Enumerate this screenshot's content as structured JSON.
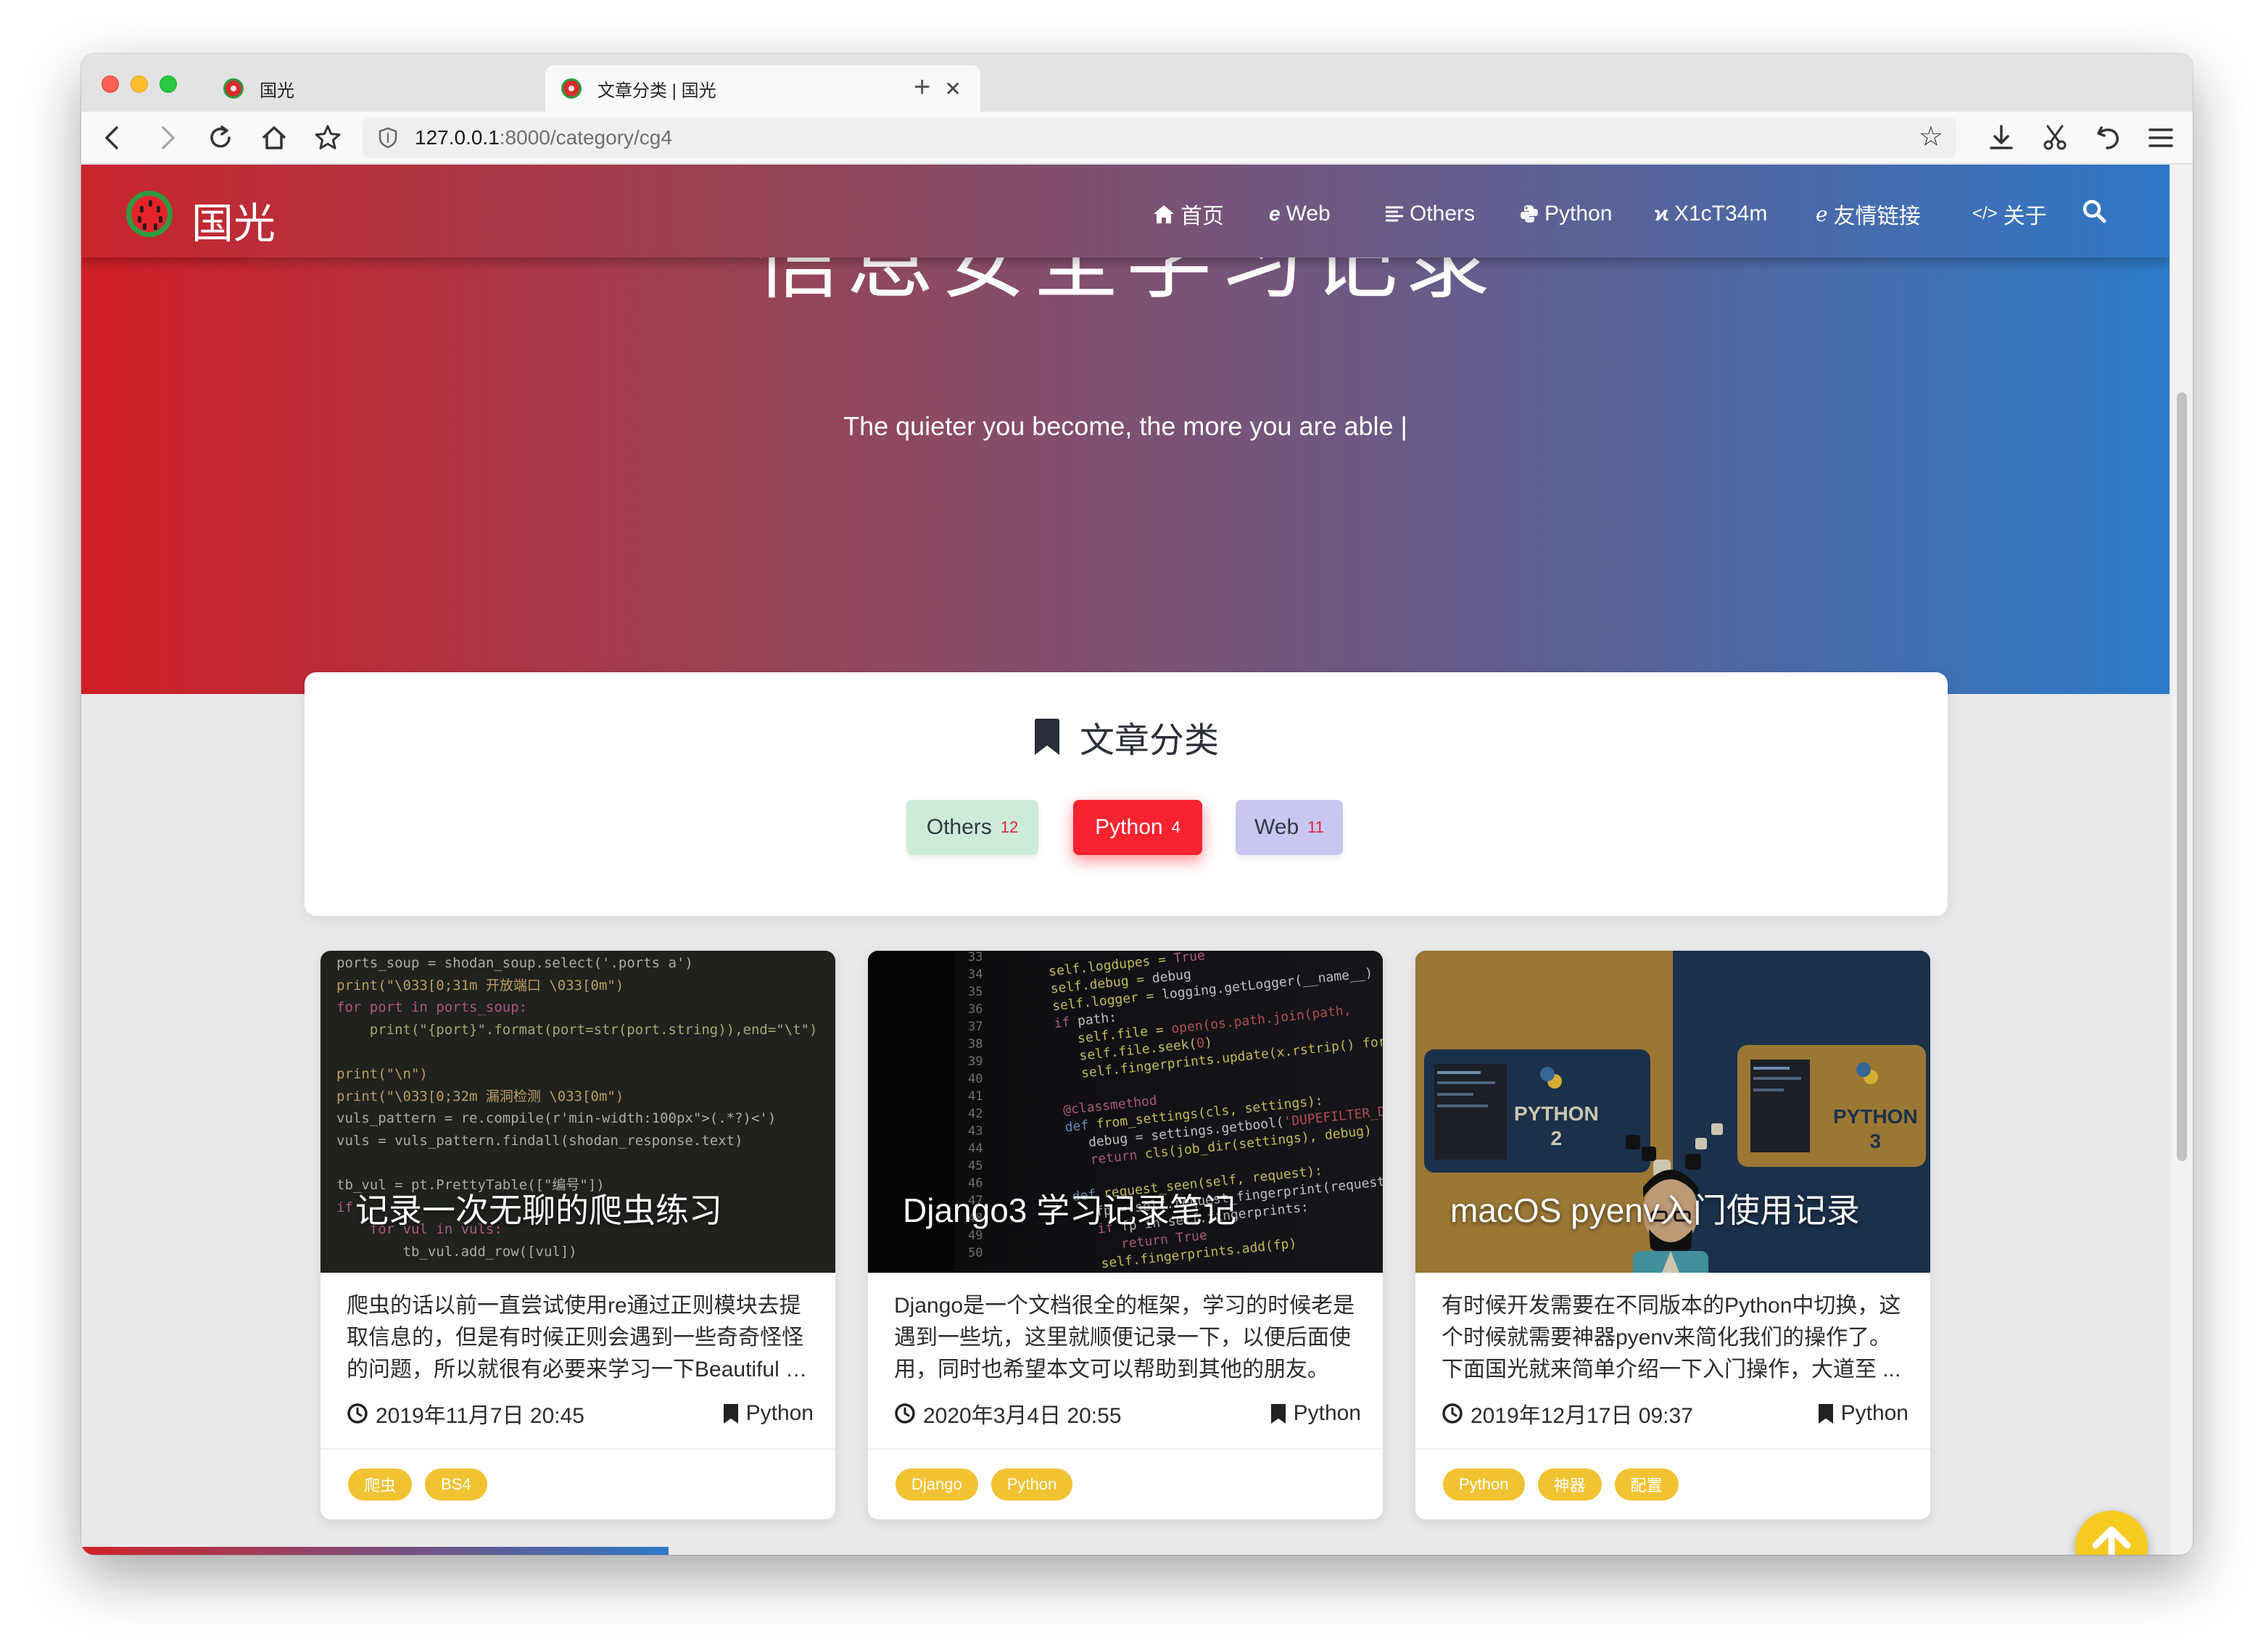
{
  "browser": {
    "tabs": [
      {
        "title": "国光"
      },
      {
        "title": "文章分类 | 国光"
      }
    ],
    "new_tab_label": "+",
    "url_host": "127.0.0.1",
    "url_path": ":8000/category/cg4"
  },
  "site": {
    "brand": "国光",
    "nav": [
      {
        "label": "首页",
        "icon": "home-icon"
      },
      {
        "label": "Web",
        "icon": "internet-explorer-icon"
      },
      {
        "label": "Others",
        "icon": "list-icon"
      },
      {
        "label": "Python",
        "icon": "python-icon"
      },
      {
        "label": "X1cT34m",
        "icon": "xing-icon"
      },
      {
        "label": "友情链接",
        "icon": "edge-icon"
      },
      {
        "label": "关于",
        "icon": "code-icon"
      }
    ]
  },
  "hero": {
    "title": "信息安全学习记录",
    "subtitle": "The quieter you become, the more you are able |"
  },
  "categories": {
    "heading": "文章分类",
    "items": [
      {
        "name": "Others",
        "count": "12"
      },
      {
        "name": "Python",
        "count": "4"
      },
      {
        "name": "Web",
        "count": "11"
      }
    ]
  },
  "articles": [
    {
      "title": "记录一次无聊的爬虫练习",
      "excerpt": "爬虫的话以前一直尝试使用re通过正则模块去提取信息的，但是有时候正则会遇到一些奇奇怪怪的问题，所以就很有必要来学习一下Beautiful S ...",
      "date": "2019年11月7日 20:45",
      "category": "Python",
      "tags": [
        "爬虫",
        "BS4"
      ]
    },
    {
      "title": "Django3 学习记录笔记",
      "excerpt": "Django是一个文档很全的框架，学习的时候老是遇到一些坑，这里就顺便记录一下，以便后面使用，同时也希望本文可以帮助到其他的朋友。",
      "date": "2020年3月4日 20:55",
      "category": "Python",
      "tags": [
        "Django",
        "Python"
      ]
    },
    {
      "title": "macOS pyenv入门使用记录",
      "excerpt": "有时候开发需要在不同版本的Python中切换，这个时候就需要神器pyenv来简化我们的操作了。下面国光就来简单介绍一下入门操作，大道至 ...",
      "date": "2019年12月17日 09:37",
      "category": "Python",
      "tags": [
        "Python",
        "神器",
        "配置"
      ]
    }
  ],
  "code_snippet": {
    "line1": "ports_soup = shodan_soup.select('.ports a')",
    "line2": "print(\"\\033[0;31m 开放端口 \\033[0m\")",
    "line3": "for port in ports_soup:",
    "line4": "    print(\"{port}\".format(port=str(port.string)),end=\"\\t\")",
    "line5": "print(\"\\n\")",
    "line6": "print(\"\\033[0;32m 漏洞检测 \\033[0m\")",
    "line7": "vuls_pattern = re.compile(r'min-width:100px\">(.*?)<')",
    "line8": "vuls = vuls_pattern.findall(shodan_response.text)",
    "line9": "tb_vul = pt.PrettyTable([\"编号\"])",
    "line10": "if",
    "line11": "    for vul in vuls:",
    "line12": "        tb_vul.add_row([vul])"
  },
  "pyenv_labels": {
    "left": "PYTHON",
    "left_version": "2",
    "right": "PYTHON",
    "right_version": "3"
  },
  "colors": {
    "brand_red": "#d11f27",
    "brand_blue": "#2c7bc8",
    "python_pill": "#f8232f",
    "others_pill": "#cdebd9",
    "web_pill": "#c9c6f2",
    "tag_yellow": "#f1c232"
  }
}
